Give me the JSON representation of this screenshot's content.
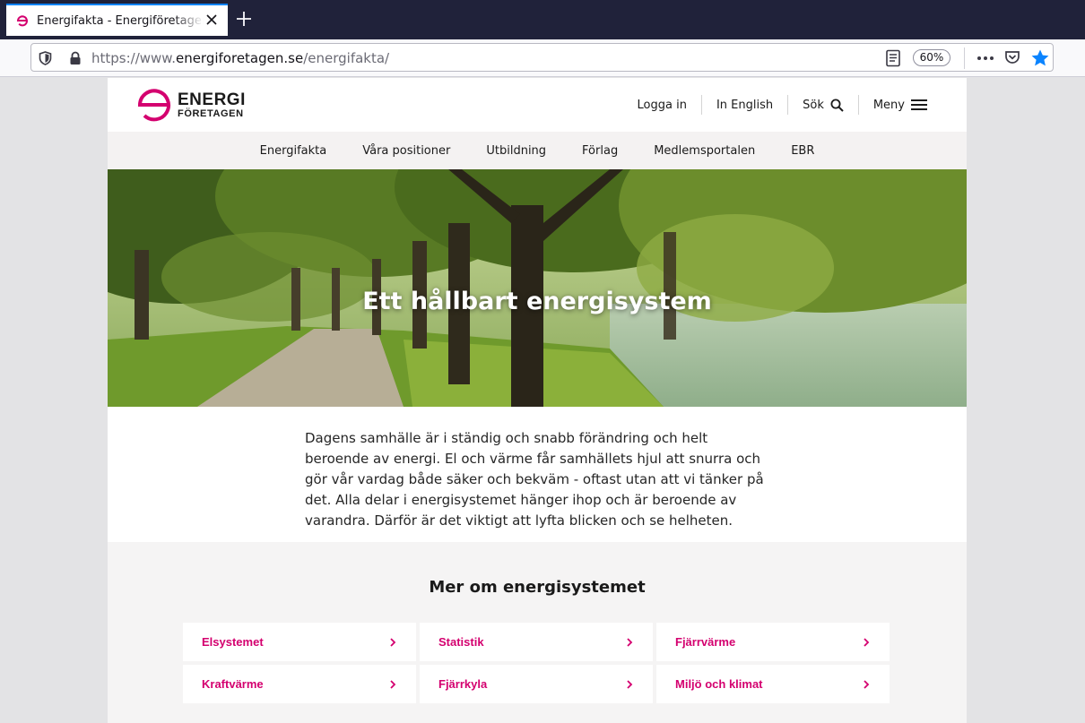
{
  "browser": {
    "tab_title": "Energifakta - Energiföretagen Sverige",
    "url_prefix": "https://www.",
    "url_domain": "energiforetagen.se",
    "url_path": "/energifakta/",
    "zoom": "60%",
    "accent_color": "#0a84ff"
  },
  "site": {
    "brand_color": "#d4006f",
    "logo_line1": "ENERGI",
    "logo_line2": "FÖRETAGEN",
    "header_links": {
      "login": "Logga in",
      "english": "In English",
      "search": "Sök",
      "menu": "Meny"
    },
    "nav": [
      "Energifakta",
      "Våra positioner",
      "Utbildning",
      "Förlag",
      "Medlemsportalen",
      "EBR"
    ],
    "hero_title": "Ett hållbart energisystem",
    "intro": "Dagens samhälle är i ständig och snabb förändring och helt beroende av energi. El och värme får samhällets hjul att snurra och gör vår vardag både säker och bekväm - oftast utan att vi tänker på det. Alla delar i energisystemet hänger ihop och är beroende av varandra. Därför är det viktigt att lyfta blicken och se helheten.",
    "more_title": "Mer om energisystemet",
    "links": [
      "Elsystemet",
      "Statistik",
      "Fjärrvärme",
      "Kraftvärme",
      "Fjärrkyla",
      "Miljö och klimat"
    ]
  }
}
